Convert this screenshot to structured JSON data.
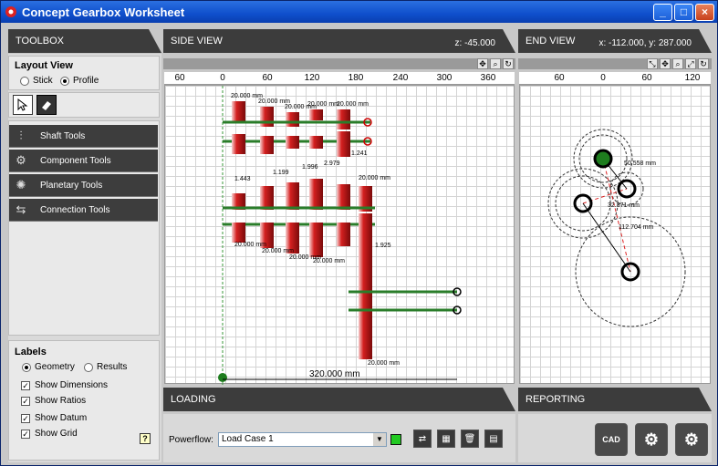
{
  "window": {
    "title": "Concept Gearbox Worksheet",
    "minimize": "_",
    "maximize": "□",
    "close": "×"
  },
  "toolbox": {
    "header": "TOOLBOX",
    "layout_view_label": "Layout View",
    "stick_label": "Stick",
    "profile_label": "Profile",
    "selected_view": "Profile",
    "tools": [
      {
        "label": "Shaft Tools",
        "icon": "shaft-icon"
      },
      {
        "label": "Component Tools",
        "icon": "gear-icon"
      },
      {
        "label": "Planetary Tools",
        "icon": "planetary-icon"
      },
      {
        "label": "Connection Tools",
        "icon": "connection-icon"
      }
    ],
    "labels_title": "Labels",
    "geometry_label": "Geometry",
    "results_label": "Results",
    "selected_labels": "Geometry",
    "checks": [
      {
        "label": "Show Dimensions",
        "checked": true
      },
      {
        "label": "Show Ratios",
        "checked": true
      },
      {
        "label": "Show Datum",
        "checked": true
      },
      {
        "label": "Show Grid",
        "checked": true
      }
    ],
    "help": "?"
  },
  "side_view": {
    "header": "SIDE VIEW",
    "coord": "z: -45.000",
    "ruler": [
      "60",
      "0",
      "60",
      "120",
      "180",
      "240",
      "300",
      "360"
    ],
    "overall_dim": "320.000 mm",
    "dims": [
      "20.000 mm",
      "20.000 mm",
      "20.000 mm",
      "20.000 mm",
      "20.000 mm",
      "1.241",
      "20.000 mm",
      "1.443",
      "1.199",
      "1.996",
      "2.979",
      "20.000 mm",
      "20.000 mm",
      "20.000 mm",
      "20.000 mm",
      "1.925",
      "20.000 mm"
    ]
  },
  "end_view": {
    "header": "END VIEW",
    "coord": "x: -112.000, y: 287.000",
    "ruler": [
      "60",
      "0",
      "60",
      "120"
    ],
    "dims": [
      "50.558 mm",
      "32.371 mm",
      "112.704 mm"
    ]
  },
  "loading": {
    "header": "LOADING",
    "powerflow_label": "Powerflow:",
    "load_case": "Load Case 1",
    "status_color": "#22c922"
  },
  "reporting": {
    "header": "REPORTING",
    "cad_label": "CAD"
  },
  "colors": {
    "header_bg": "#3c3c3c",
    "gear_red": "#c8171d",
    "shaft_green": "#2a7d2a"
  }
}
